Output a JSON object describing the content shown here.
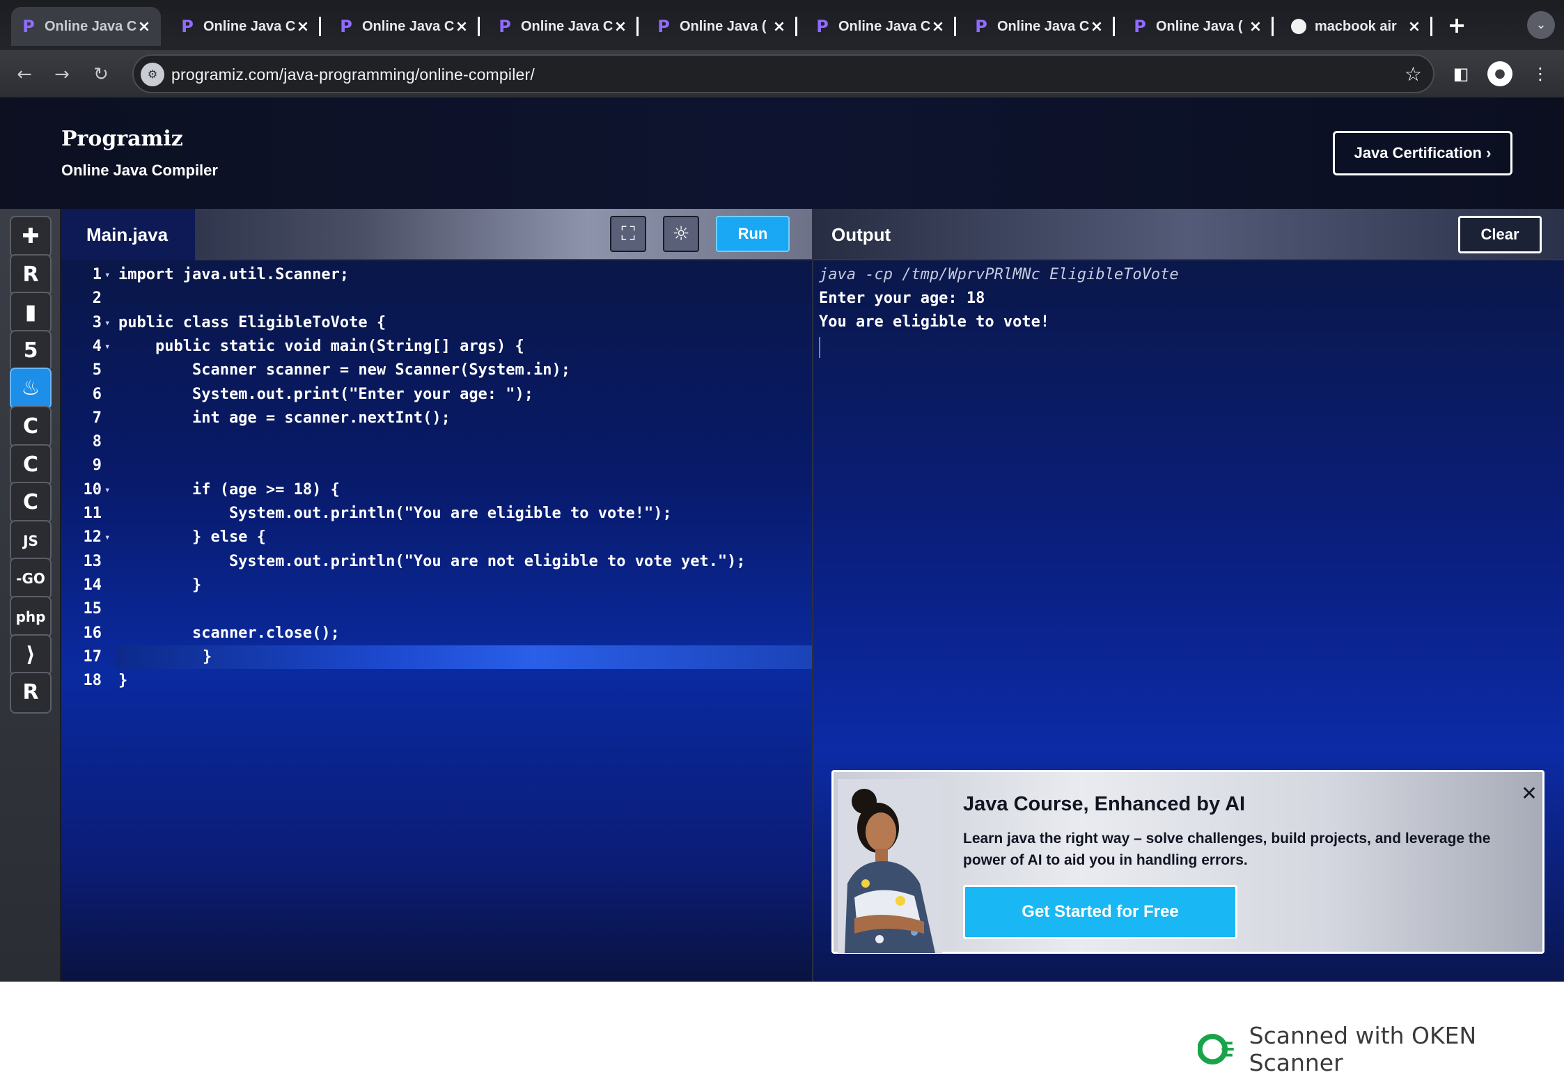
{
  "browser": {
    "tabs": [
      {
        "label": "Online Java C",
        "active": true,
        "favicon": "programiz"
      },
      {
        "label": "Online Java C",
        "active": false,
        "favicon": "programiz"
      },
      {
        "label": "Online Java C",
        "active": false,
        "favicon": "programiz"
      },
      {
        "label": "Online Java C",
        "active": false,
        "favicon": "programiz"
      },
      {
        "label": "Online Java (",
        "active": false,
        "favicon": "programiz"
      },
      {
        "label": "Online Java C",
        "active": false,
        "favicon": "programiz"
      },
      {
        "label": "Online Java C",
        "active": false,
        "favicon": "programiz"
      },
      {
        "label": "Online Java (",
        "active": false,
        "favicon": "programiz"
      },
      {
        "label": "macbook air",
        "active": false,
        "favicon": "globe"
      }
    ],
    "new_tab_icon": "+",
    "url": "programiz.com/java-programming/online-compiler/"
  },
  "site": {
    "logo": "Programiz",
    "subtitle": "Online Java Compiler",
    "cert_button": "Java Certification ›"
  },
  "sidebar": {
    "languages": [
      {
        "name": "python-icon",
        "glyph": "✚"
      },
      {
        "name": "r-icon",
        "glyph": "R"
      },
      {
        "name": "sql-icon",
        "glyph": "▮"
      },
      {
        "name": "html-icon",
        "glyph": "5"
      },
      {
        "name": "java-icon",
        "glyph": "♨",
        "active": true
      },
      {
        "name": "c-icon",
        "glyph": "C"
      },
      {
        "name": "cpp-icon",
        "glyph": "C"
      },
      {
        "name": "csharp-icon",
        "glyph": "C"
      },
      {
        "name": "js-icon",
        "glyph": "JS"
      },
      {
        "name": "go-icon",
        "glyph": "-GO"
      },
      {
        "name": "php-icon",
        "glyph": "php"
      },
      {
        "name": "swift-icon",
        "glyph": "⟩"
      },
      {
        "name": "rust-icon",
        "glyph": "R"
      }
    ]
  },
  "editor": {
    "filename": "Main.java",
    "run_label": "Run",
    "lines": [
      {
        "n": "1",
        "fold": true,
        "text": "import java.util.Scanner;"
      },
      {
        "n": "2",
        "fold": false,
        "text": ""
      },
      {
        "n": "3",
        "fold": true,
        "text": "public class EligibleToVote {"
      },
      {
        "n": "4",
        "fold": true,
        "text": "    public static void main(String[] args) {"
      },
      {
        "n": "5",
        "fold": false,
        "text": "        Scanner scanner = new Scanner(System.in);"
      },
      {
        "n": "6",
        "fold": false,
        "text": "        System.out.print(\"Enter your age: \");"
      },
      {
        "n": "7",
        "fold": false,
        "text": "        int age = scanner.nextInt();"
      },
      {
        "n": "8",
        "fold": false,
        "text": ""
      },
      {
        "n": "9",
        "fold": false,
        "text": ""
      },
      {
        "n": "10",
        "fold": true,
        "text": "        if (age >= 18) {"
      },
      {
        "n": "11",
        "fold": false,
        "text": "            System.out.println(\"You are eligible to vote!\");"
      },
      {
        "n": "12",
        "fold": true,
        "text": "        } else {"
      },
      {
        "n": "13",
        "fold": false,
        "text": "            System.out.println(\"You are not eligible to vote yet.\");"
      },
      {
        "n": "14",
        "fold": false,
        "text": "        }"
      },
      {
        "n": "15",
        "fold": false,
        "text": ""
      },
      {
        "n": "16",
        "fold": false,
        "text": "        scanner.close();"
      },
      {
        "n": "17",
        "fold": false,
        "text": "    }",
        "highlight": true
      },
      {
        "n": "18",
        "fold": false,
        "text": "}"
      }
    ]
  },
  "output": {
    "title": "Output",
    "clear_label": "Clear",
    "lines": [
      {
        "text": "java -cp /tmp/WprvPRlMNc EligibleToVote",
        "type": "cmd"
      },
      {
        "text": "Enter your age: 18",
        "type": "out"
      },
      {
        "text": "You are eligible to vote!",
        "type": "out"
      }
    ]
  },
  "promo": {
    "title": "Java Course, Enhanced by AI",
    "description": "Learn java the right way – solve challenges, build projects, and leverage the power of AI to aid you in handling errors.",
    "cta": "Get Started for Free",
    "close": "✕"
  },
  "watermark": {
    "text": "Scanned with OKEN Scanner"
  }
}
